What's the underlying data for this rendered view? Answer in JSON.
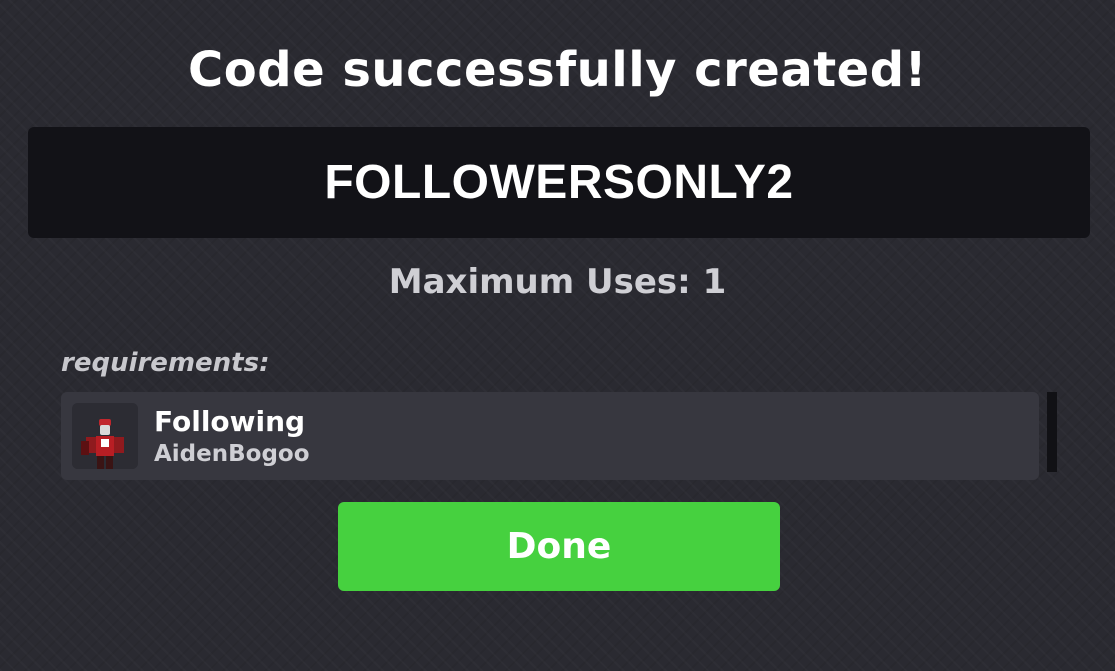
{
  "dialog": {
    "title": "Code successfully created!",
    "code": "FOLLOWERSONLY2",
    "max_uses_text": "Maximum Uses: 1"
  },
  "requirements": {
    "label": "requirements:",
    "items": [
      {
        "type_label": "Following",
        "username": "AidenBogoo",
        "avatar_icon": "roblox-avatar-icon"
      }
    ]
  },
  "actions": {
    "done_label": "Done"
  },
  "colors": {
    "background": "#2a2a31",
    "code_box": "#121217",
    "requirement_card": "#37373f",
    "done_button": "#46d13f"
  }
}
